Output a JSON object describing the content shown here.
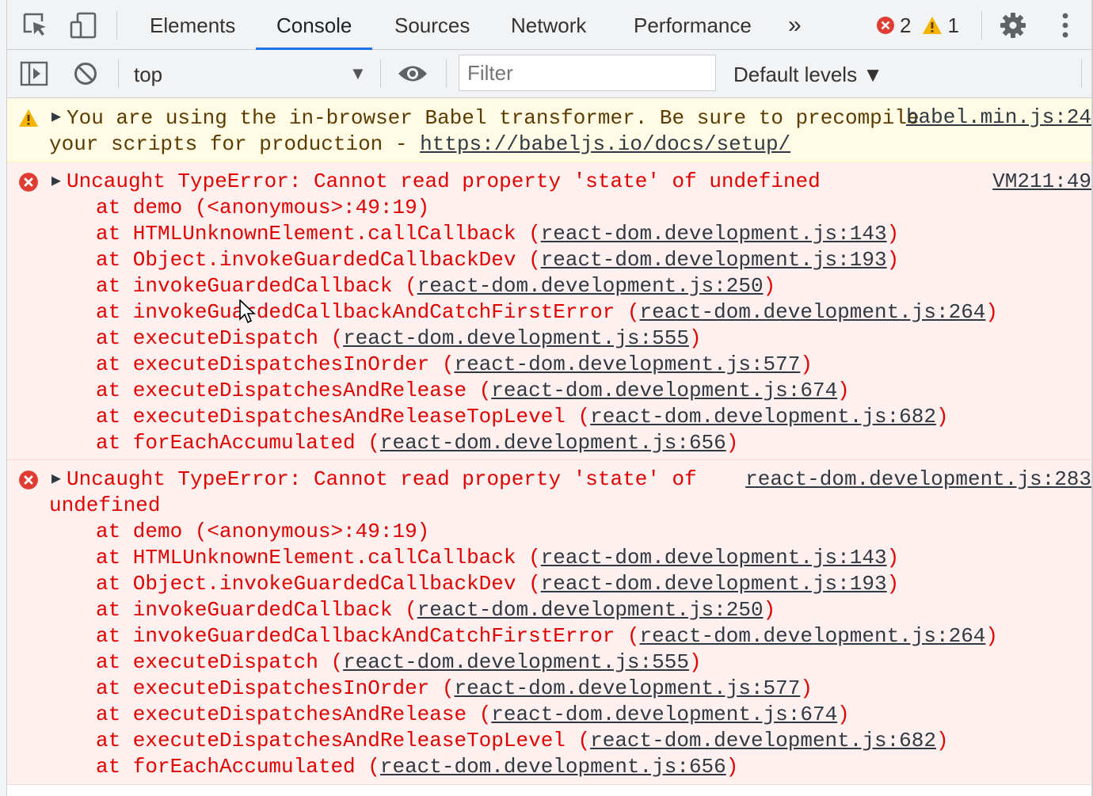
{
  "tabs": {
    "items": [
      "Elements",
      "Console",
      "Sources",
      "Network",
      "Performance"
    ],
    "more": "»",
    "error_count": "2",
    "warning_count": "1"
  },
  "toolbar": {
    "context": "top",
    "filter_placeholder": "Filter",
    "levels": "Default levels ▼"
  },
  "colors": {
    "accent": "#1a73e8",
    "error_text": "#e00000",
    "error_bg": "#fff0f0",
    "warning_bg": "#fffbe5",
    "warning_icon": "#f4b400"
  },
  "messages": [
    {
      "level": "warning",
      "text_line1": "You are using the in-browser Babel transformer. Be sure to precompile",
      "text_line2_prefix": "your scripts for production - ",
      "text_link": "https://babeljs.io/docs/setup/",
      "source": "babel.min.js:24"
    },
    {
      "level": "error",
      "text": "Uncaught TypeError: Cannot read property 'state' of undefined",
      "source": "VM211:49",
      "stack": [
        {
          "fn": "at demo ",
          "loc": "(<anonymous>:49:19)",
          "link": false
        },
        {
          "fn": "at HTMLUnknownElement.callCallback ",
          "loc": "react-dom.development.js:143",
          "link": true
        },
        {
          "fn": "at Object.invokeGuardedCallbackDev ",
          "loc": "react-dom.development.js:193",
          "link": true
        },
        {
          "fn": "at invokeGuardedCallback ",
          "loc": "react-dom.development.js:250",
          "link": true
        },
        {
          "fn": "at invokeGuardedCallbackAndCatchFirstError ",
          "loc": "react-dom.development.js:264",
          "link": true
        },
        {
          "fn": "at executeDispatch ",
          "loc": "react-dom.development.js:555",
          "link": true
        },
        {
          "fn": "at executeDispatchesInOrder ",
          "loc": "react-dom.development.js:577",
          "link": true
        },
        {
          "fn": "at executeDispatchesAndRelease ",
          "loc": "react-dom.development.js:674",
          "link": true
        },
        {
          "fn": "at executeDispatchesAndReleaseTopLevel ",
          "loc": "react-dom.development.js:682",
          "link": true
        },
        {
          "fn": "at forEachAccumulated ",
          "loc": "react-dom.development.js:656",
          "link": true
        }
      ]
    },
    {
      "level": "error",
      "text_line1": "Uncaught TypeError: Cannot read property 'state' of",
      "text_line2": "undefined",
      "source": "react-dom.development.js:283",
      "stack": [
        {
          "fn": "at demo ",
          "loc": "(<anonymous>:49:19)",
          "link": false
        },
        {
          "fn": "at HTMLUnknownElement.callCallback ",
          "loc": "react-dom.development.js:143",
          "link": true
        },
        {
          "fn": "at Object.invokeGuardedCallbackDev ",
          "loc": "react-dom.development.js:193",
          "link": true
        },
        {
          "fn": "at invokeGuardedCallback ",
          "loc": "react-dom.development.js:250",
          "link": true
        },
        {
          "fn": "at invokeGuardedCallbackAndCatchFirstError ",
          "loc": "react-dom.development.js:264",
          "link": true
        },
        {
          "fn": "at executeDispatch ",
          "loc": "react-dom.development.js:555",
          "link": true
        },
        {
          "fn": "at executeDispatchesInOrder ",
          "loc": "react-dom.development.js:577",
          "link": true
        },
        {
          "fn": "at executeDispatchesAndRelease ",
          "loc": "react-dom.development.js:674",
          "link": true
        },
        {
          "fn": "at executeDispatchesAndReleaseTopLevel ",
          "loc": "react-dom.development.js:682",
          "link": true
        },
        {
          "fn": "at forEachAccumulated ",
          "loc": "react-dom.development.js:656",
          "link": true
        }
      ]
    }
  ]
}
